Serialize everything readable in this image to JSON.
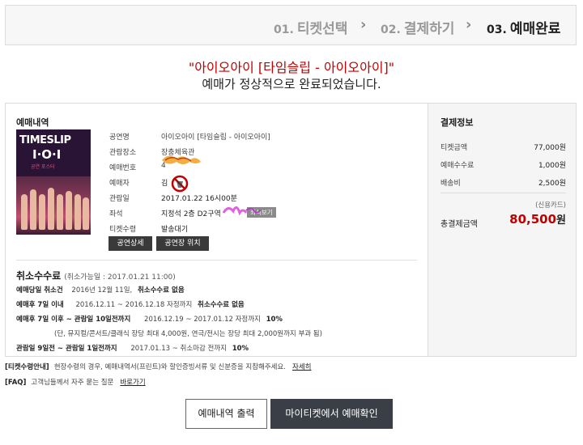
{
  "steps": [
    {
      "num": "01.",
      "label": "티켓선택"
    },
    {
      "num": "02.",
      "label": "결제하기"
    },
    {
      "num": "03.",
      "label": "예매완료"
    }
  ],
  "headline": {
    "title": "\"아이오아이 [타임슬립 - 아이오아이]\"",
    "message": "예매가 정상적으로 완료되었습니다."
  },
  "booking": {
    "section_title": "예매내역",
    "poster": {
      "line1": "TIMESLIP",
      "line2": "I·O·I",
      "line3": "공연 포스터"
    },
    "rows": [
      {
        "label": "공연명",
        "value": "아이오아이 [타임슬립 - 아이오아이]"
      },
      {
        "label": "관람장소",
        "value": "장충체육관"
      },
      {
        "label": "예매번호",
        "value": "4"
      },
      {
        "label": "예매자",
        "value": "김"
      },
      {
        "label": "관람일",
        "value": "2017.01.22 16시00분"
      },
      {
        "label": "좌석",
        "value": "지정석 2층 D2구역",
        "link": "좌석보기"
      },
      {
        "label": "티켓수령",
        "value": "발송대기"
      }
    ],
    "buttons": {
      "detail": "공연상세",
      "venue": "공연장 위치"
    }
  },
  "cancel_fee": {
    "title": "취소수수료",
    "subtitle": "(취소가능일 : 2017.01.21 11:00)",
    "rows": [
      {
        "label": "예매당일 취소건",
        "period": "2016년 12월 11일,",
        "fee": "취소수수료 없음"
      },
      {
        "label": "예매후 7일 이내",
        "period": "2016.12.11 ~ 2016.12.18 자정까지",
        "fee": "취소수수료 없음"
      },
      {
        "label": "예매후 7일 이후 ~ 관람일 10일전까지",
        "period": "2016.12.19 ~ 2017.01.12 자정까지",
        "fee": "10%"
      },
      {
        "label": "",
        "period": "(단, 뮤지컬/콘서트/클래식 장당 최대 4,000원, 연극/전시는 장당 최대 2,000원까지 부과 됨)",
        "fee": ""
      },
      {
        "label": "관람일 9일전 ~ 관람일 1일전까지",
        "period": "2017.01.13 ~ 취소마감 전까지",
        "fee": "10%"
      }
    ]
  },
  "payment": {
    "title": "결제정보",
    "rows": [
      {
        "label": "티켓금액",
        "amount": "77,000원"
      },
      {
        "label": "예매수수료",
        "amount": "1,000원"
      },
      {
        "label": "배송비",
        "amount": "2,500원"
      }
    ],
    "method": "(신용카드)",
    "total_label": "총결제금액",
    "total_amount": "80,500",
    "total_unit": "원"
  },
  "notes": [
    {
      "tag": "[티켓수령안내]",
      "text": "현장수령의 경우, 예매내역서(프린트)와 할인증빙서류 및 신분증을 지참해주세요.",
      "link": "자세히"
    },
    {
      "tag": "[FAQ]",
      "text": "고객님들께서 자주 묻는 질문",
      "link": "바로가기"
    }
  ],
  "actions": {
    "print": "예매내역 출력",
    "confirm": "마이티켓에서 예매확인"
  },
  "colors": {
    "accent_red": "#c00000",
    "dark_button": "#3a3f47"
  }
}
